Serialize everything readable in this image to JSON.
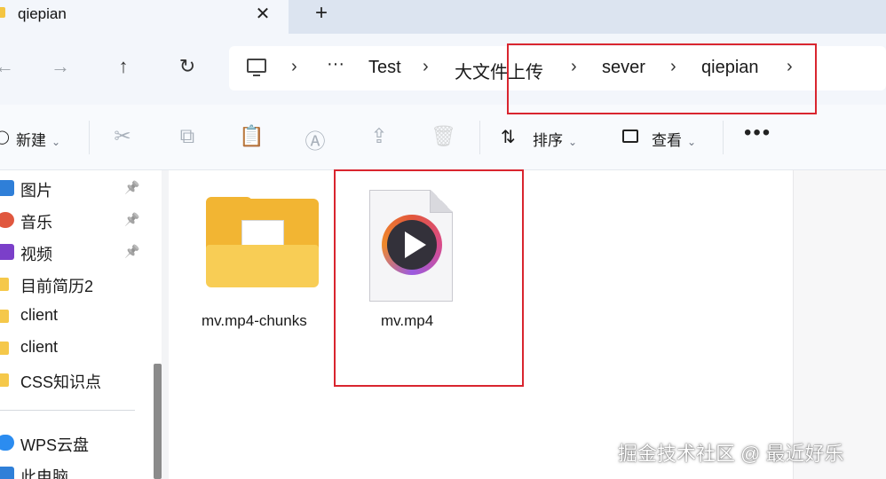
{
  "tab": {
    "title": "qiepian",
    "close_glyph": "✕",
    "new_glyph": "+"
  },
  "nav": {
    "back_glyph": "←",
    "forward_glyph": "→",
    "up_glyph": "↑",
    "refresh_glyph": "↻",
    "more_glyph": "···",
    "separator": "›",
    "breadcrumb": [
      "Test",
      "大文件上传",
      "sever",
      "qiepian"
    ]
  },
  "toolbar": {
    "new_label": "新建",
    "sort_label": "排序",
    "view_label": "查看",
    "more_glyph": "•••",
    "chevron": "⌄",
    "sort_icon_glyph": "⇅",
    "icons": {
      "cut": "✂",
      "copy": "⧉",
      "paste": "📋",
      "rename": "Ⓐ",
      "share": "⇪",
      "delete": "🗑"
    }
  },
  "sidebar": {
    "items": [
      {
        "label": "图片",
        "icon": "pictures-icon",
        "color": "#2f7fd8",
        "pinned": true
      },
      {
        "label": "音乐",
        "icon": "music-icon",
        "color": "#e0573e",
        "pinned": true
      },
      {
        "label": "视频",
        "icon": "videos-icon",
        "color": "#7b3fc9",
        "pinned": true
      },
      {
        "label": "目前简历2",
        "icon": "folder-icon",
        "pinned": false
      },
      {
        "label": "client",
        "icon": "folder-icon",
        "pinned": false
      },
      {
        "label": "client",
        "icon": "folder-icon",
        "pinned": false
      },
      {
        "label": "CSS知识点",
        "icon": "folder-icon",
        "pinned": false
      }
    ],
    "pin_glyph": "📌",
    "bottom_items": [
      {
        "label": "WPS云盘",
        "icon": "wps-cloud-icon",
        "color": "#2b8cf0"
      },
      {
        "label": "此电脑",
        "icon": "this-pc-icon",
        "color": "#2f7fd8"
      }
    ]
  },
  "files": [
    {
      "name": "mv.mp4-chunks",
      "type": "folder"
    },
    {
      "name": "mv.mp4",
      "type": "video"
    }
  ],
  "watermark": "掘金技术社区 @ 最近好乐",
  "colors": {
    "highlight": "#d9252f",
    "folder": "#f2b533"
  }
}
